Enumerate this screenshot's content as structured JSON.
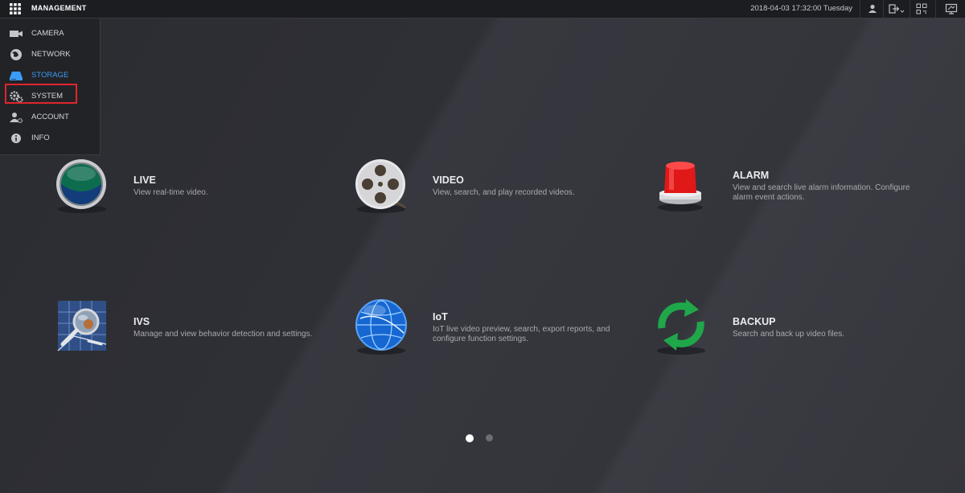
{
  "header": {
    "title": "MANAGEMENT",
    "datetime": "2018-04-03 17:32:00 Tuesday"
  },
  "menu": {
    "items": [
      {
        "label": "CAMERA",
        "icon": "camera-icon"
      },
      {
        "label": "NETWORK",
        "icon": "network-globe-icon"
      },
      {
        "label": "STORAGE",
        "icon": "storage-disk-icon",
        "active": true
      },
      {
        "label": "SYSTEM",
        "icon": "gears-icon"
      },
      {
        "label": "ACCOUNT",
        "icon": "account-user-icon"
      },
      {
        "label": "INFO",
        "icon": "info-icon"
      }
    ]
  },
  "tiles": [
    {
      "title": "LIVE",
      "desc": "View real-time video.",
      "icon": "live-orb-icon"
    },
    {
      "title": "VIDEO",
      "desc": "View, search, and play recorded videos.",
      "icon": "film-reel-icon"
    },
    {
      "title": "ALARM",
      "desc": "View and search live alarm information. Configure alarm event actions.",
      "icon": "alarm-siren-icon"
    },
    {
      "title": "IVS",
      "desc": "Manage and view behavior detection and settings.",
      "icon": "magnifier-icon"
    },
    {
      "title": "IoT",
      "desc": "IoT live video preview, search, export reports, and configure function settings.",
      "icon": "globe-icon"
    },
    {
      "title": "BACKUP",
      "desc": "Search and back up video files.",
      "icon": "backup-arrows-icon"
    }
  ],
  "pagination": {
    "pages": 2,
    "current": 1
  },
  "colors": {
    "accent": "#3b9cf5",
    "highlight": "#e0252c"
  }
}
